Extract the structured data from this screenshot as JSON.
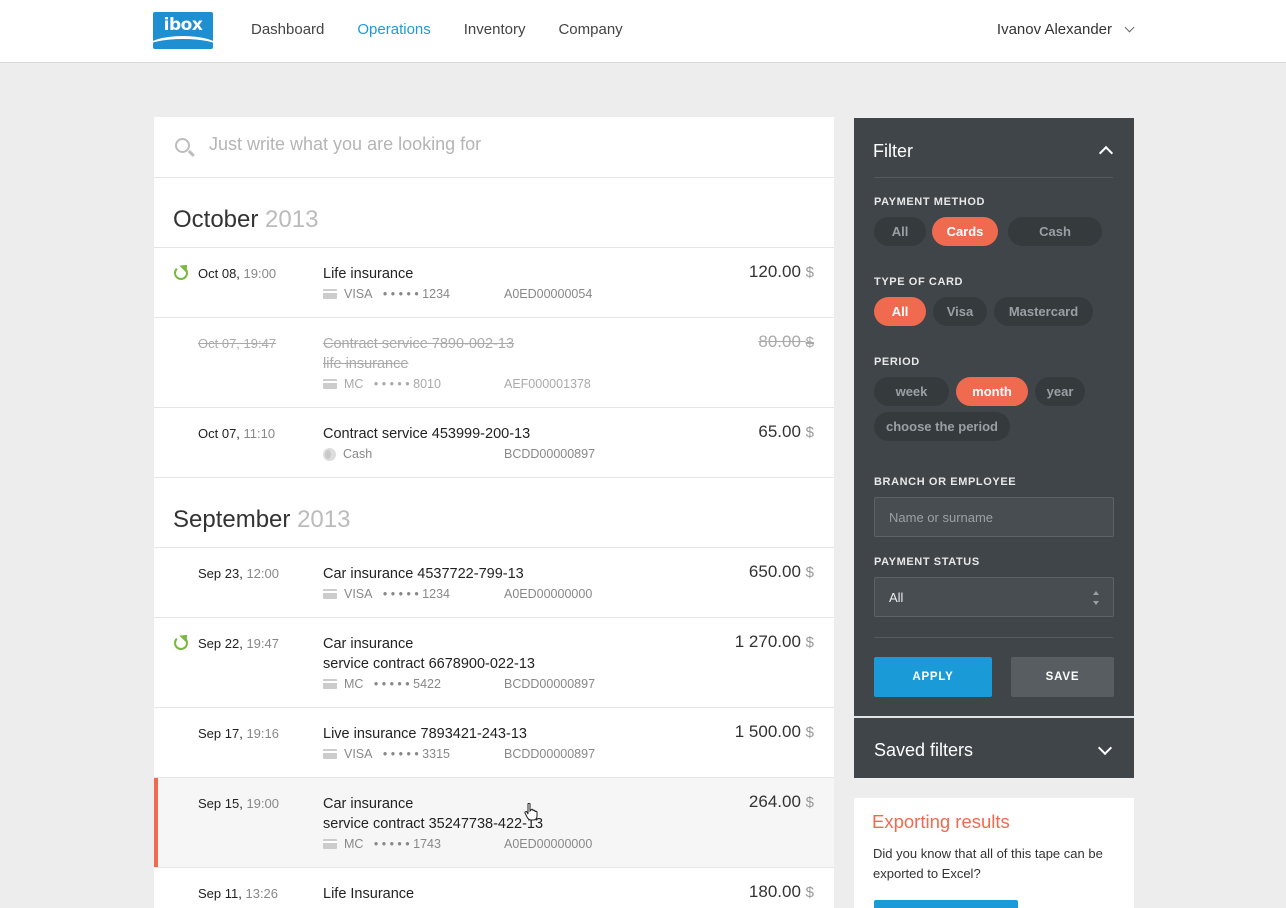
{
  "app": {
    "logo_text": "ibox",
    "brand_color": "#1e8fd0",
    "accent_color": "#f06a4f"
  },
  "nav": {
    "items": [
      "Dashboard",
      "Operations",
      "Inventory",
      "Company"
    ],
    "active": "Operations"
  },
  "user": {
    "name": "Ivanov Alexander"
  },
  "search": {
    "placeholder": "Just write what you are looking for"
  },
  "months": [
    {
      "name": "October",
      "year": "2013",
      "rows": [
        {
          "date": "Oct 08,",
          "time": "19:00",
          "title": "Life insurance",
          "title2": "",
          "method": "VISA",
          "masked": "• • • • • 1234",
          "code": "A0ED00000054",
          "amount": "120.00",
          "currency": "$",
          "recurring": true,
          "canceled": false,
          "selected": false,
          "icon": "card-icon"
        },
        {
          "date": "Oct 07,",
          "time": "19:47",
          "title": "Contract service 7890-002-13",
          "title2": "life insurance",
          "method": "MC",
          "masked": "• • • • • 8010",
          "code": "AEF000001378",
          "amount": "80.00",
          "currency": "$",
          "recurring": false,
          "canceled": true,
          "selected": false,
          "icon": "card-icon"
        },
        {
          "date": "Oct 07,",
          "time": "11:10",
          "title": "Contract service 453999-200-13",
          "title2": "",
          "method": "Cash",
          "masked": "",
          "code": "BCDD00000897",
          "amount": "65.00",
          "currency": "$",
          "recurring": false,
          "canceled": false,
          "selected": false,
          "icon": "cash-icon"
        }
      ]
    },
    {
      "name": "September",
      "year": "2013",
      "rows": [
        {
          "date": "Sep 23,",
          "time": "12:00",
          "title": "Car insurance 4537722-799-13",
          "title2": "",
          "method": "VISA",
          "masked": "• • • • • 1234",
          "code": "A0ED00000000",
          "amount": "650.00",
          "currency": "$",
          "recurring": false,
          "canceled": false,
          "selected": false,
          "icon": "card-icon"
        },
        {
          "date": "Sep 22,",
          "time": "19:47",
          "title": "Car insurance",
          "title2": "service contract 6678900-022-13",
          "method": "MC",
          "masked": "• • • • • 5422",
          "code": "BCDD00000897",
          "amount": "1 270.00",
          "currency": "$",
          "recurring": true,
          "canceled": false,
          "selected": false,
          "icon": "card-icon"
        },
        {
          "date": "Sep 17,",
          "time": "19:16",
          "title": "Live insurance 7893421-243-13",
          "title2": "",
          "method": "VISA",
          "masked": "• • • • • 3315",
          "code": "BCDD00000897",
          "amount": "1 500.00",
          "currency": "$",
          "recurring": false,
          "canceled": false,
          "selected": false,
          "icon": "card-icon"
        },
        {
          "date": "Sep 15,",
          "time": "19:00",
          "title": "Car insurance",
          "title2": "service contract 35247738-422-13",
          "method": "MC",
          "masked": "• • • • • 1743",
          "code": "A0ED00000000",
          "amount": "264.00",
          "currency": "$",
          "recurring": false,
          "canceled": false,
          "selected": true,
          "icon": "card-icon"
        },
        {
          "date": "Sep 11,",
          "time": "13:26",
          "title": "Life Insurance",
          "title2": "",
          "method": "",
          "masked": "",
          "code": "",
          "amount": "180.00",
          "currency": "$",
          "recurring": false,
          "canceled": false,
          "selected": false,
          "icon": ""
        }
      ]
    }
  ],
  "filter": {
    "title": "Filter",
    "payment_method": {
      "label": "PAYMENT METHOD",
      "options": [
        "All",
        "Cards",
        "Cash"
      ],
      "selected": "Cards"
    },
    "card_type": {
      "label": "TYPE OF CARD",
      "options": [
        "All",
        "Visa",
        "Mastercard"
      ],
      "selected": "All"
    },
    "period": {
      "label": "PERIOD",
      "options": [
        "week",
        "month",
        "year",
        "choose the period"
      ],
      "selected": "month"
    },
    "branch": {
      "label": "BRANCH OR EMPLOYEE",
      "placeholder": "Name or surname"
    },
    "status": {
      "label": "PAYMENT STATUS",
      "value": "All"
    },
    "apply_label": "APPLY",
    "save_label": "SAVE",
    "saved_filters": "Saved filters"
  },
  "export": {
    "title": "Exporting results",
    "text": "Did you know that all of this tape can be exported to Excel?"
  }
}
